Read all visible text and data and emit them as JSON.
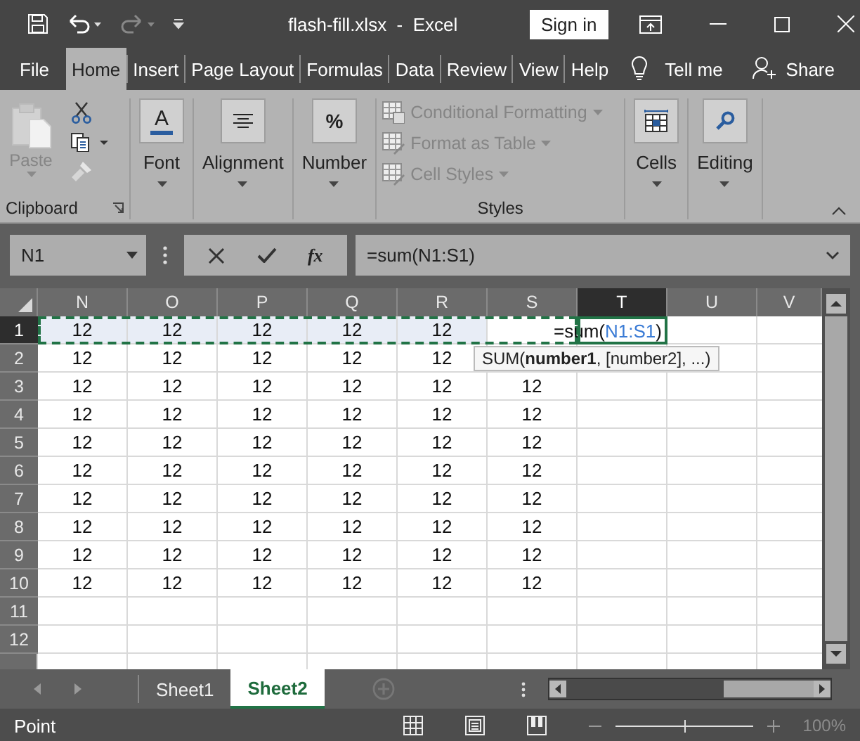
{
  "title_bar": {
    "title": "flash-fill.xlsx  -  Excel",
    "sign_in": "Sign in"
  },
  "ribbon_tabs": [
    {
      "label": "File",
      "selected": false
    },
    {
      "label": "Home",
      "selected": true
    },
    {
      "label": "Insert",
      "selected": false
    },
    {
      "label": "Page Layout",
      "selected": false
    },
    {
      "label": "Formulas",
      "selected": false
    },
    {
      "label": "Data",
      "selected": false
    },
    {
      "label": "Review",
      "selected": false
    },
    {
      "label": "View",
      "selected": false
    },
    {
      "label": "Help",
      "selected": false
    }
  ],
  "tell_me": "Tell me",
  "share": "Share",
  "clipboard": {
    "paste": "Paste",
    "paste_disabled": true,
    "label": "Clipboard"
  },
  "collapsed_groups": [
    {
      "kind": "font",
      "glyph": "A",
      "label": "Font"
    },
    {
      "kind": "alignment",
      "label": "Alignment"
    },
    {
      "kind": "number",
      "glyph": "%",
      "label": "Number"
    }
  ],
  "styles": {
    "label": "Styles",
    "items": [
      {
        "kind": "conditional",
        "label": "Conditional Formatting",
        "disabled": true
      },
      {
        "kind": "table",
        "label": "Format as Table",
        "disabled": true
      },
      {
        "kind": "cellstyles",
        "label": "Cell Styles",
        "disabled": true
      }
    ]
  },
  "right_groups": [
    {
      "kind": "cells",
      "label": "Cells"
    },
    {
      "kind": "editing",
      "label": "Editing"
    }
  ],
  "formula_bar": {
    "name_box": "N1",
    "function_button": "fx",
    "formula": "=sum(N1:S1)"
  },
  "columns": [
    {
      "label": "N",
      "selected": false
    },
    {
      "label": "O",
      "selected": false
    },
    {
      "label": "P",
      "selected": false
    },
    {
      "label": "Q",
      "selected": false
    },
    {
      "label": "R",
      "selected": false
    },
    {
      "label": "S",
      "selected": false
    },
    {
      "label": "T",
      "selected": true
    },
    {
      "label": "U",
      "selected": false
    },
    {
      "label": "V",
      "selected": false
    }
  ],
  "rows": [
    {
      "header": "1",
      "selected": true,
      "cells": [
        "12",
        "12",
        "12",
        "12",
        "12"
      ]
    },
    {
      "header": "2",
      "selected": false,
      "cells": [
        "12",
        "12",
        "12",
        "12",
        "12"
      ]
    },
    {
      "header": "3",
      "selected": false,
      "cells": [
        "12",
        "12",
        "12",
        "12",
        "12",
        "12"
      ]
    },
    {
      "header": "4",
      "selected": false,
      "cells": [
        "12",
        "12",
        "12",
        "12",
        "12",
        "12"
      ]
    },
    {
      "header": "5",
      "selected": false,
      "cells": [
        "12",
        "12",
        "12",
        "12",
        "12",
        "12"
      ]
    },
    {
      "header": "6",
      "selected": false,
      "cells": [
        "12",
        "12",
        "12",
        "12",
        "12",
        "12"
      ]
    },
    {
      "header": "7",
      "selected": false,
      "cells": [
        "12",
        "12",
        "12",
        "12",
        "12",
        "12"
      ]
    },
    {
      "header": "8",
      "selected": false,
      "cells": [
        "12",
        "12",
        "12",
        "12",
        "12",
        "12"
      ]
    },
    {
      "header": "9",
      "selected": false,
      "cells": [
        "12",
        "12",
        "12",
        "12",
        "12",
        "12"
      ]
    },
    {
      "header": "10",
      "selected": false,
      "cells": [
        "12",
        "12",
        "12",
        "12",
        "12",
        "12"
      ]
    },
    {
      "header": "11",
      "selected": false,
      "cells": []
    },
    {
      "header": "12",
      "selected": false,
      "cells": []
    }
  ],
  "cell_edit": {
    "prefix": "=sum(",
    "reference": "N1:S1",
    "suffix": ")",
    "reference_marquee": true
  },
  "tooltip": "SUM(**number1**, [number2], ...)",
  "sheet_tabs": [
    {
      "label": "Sheet1",
      "selected": false
    },
    {
      "label": "Sheet2",
      "selected": true
    }
  ],
  "status_bar": {
    "mode": "Point",
    "zoom": {
      "level": 0.5,
      "reading": "100%"
    }
  }
}
